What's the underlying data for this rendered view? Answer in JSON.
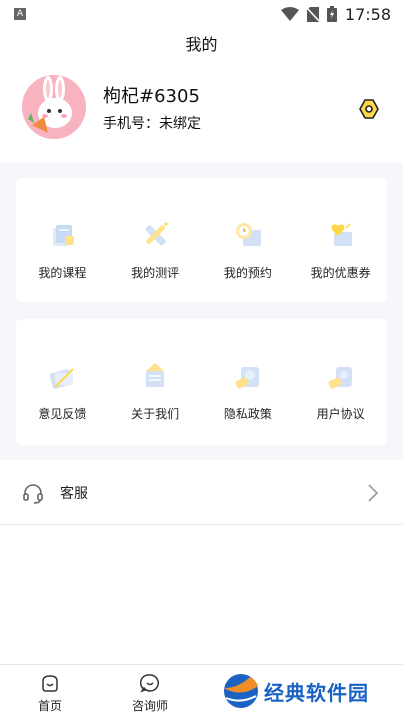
{
  "status_bar": {
    "notification_glyph": "A",
    "time": "17:58"
  },
  "header": {
    "title": "我的"
  },
  "profile": {
    "username": "枸杞#6305",
    "phone": "手机号：未绑定"
  },
  "menu_primary": [
    {
      "label": "我的课程",
      "icon": "book-icon"
    },
    {
      "label": "我的测评",
      "icon": "pencil-ruler-icon"
    },
    {
      "label": "我的预约",
      "icon": "clock-calendar-icon"
    },
    {
      "label": "我的优惠券",
      "icon": "heart-coupon-icon"
    }
  ],
  "menu_secondary": [
    {
      "label": "意见反馈",
      "icon": "feedback-icon"
    },
    {
      "label": "关于我们",
      "icon": "about-icon"
    },
    {
      "label": "隐私政策",
      "icon": "privacy-icon"
    },
    {
      "label": "用户协议",
      "icon": "agreement-icon"
    }
  ],
  "service": {
    "label": "客服"
  },
  "tabbar": {
    "home": "首页",
    "consultant": "咨询师"
  },
  "watermark": {
    "text": "经典软件园"
  },
  "colors": {
    "accent_yellow": "#ffd84a",
    "watermark_blue": "#1a62c4",
    "avatar_pink": "#f7b3bf"
  }
}
